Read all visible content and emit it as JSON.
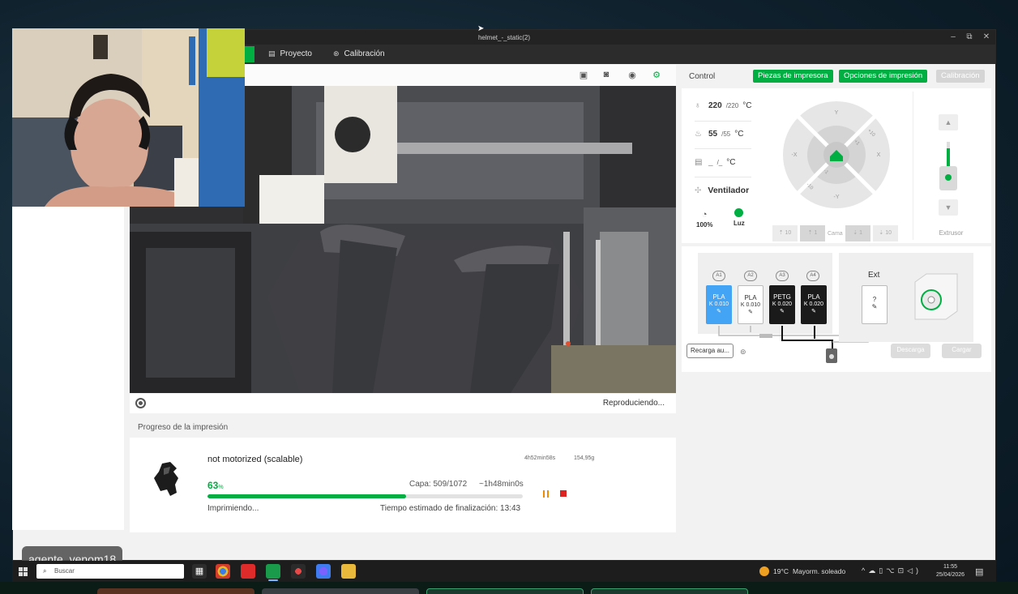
{
  "window": {
    "title": "helmet_-_static(2)",
    "controls": {
      "minimize": "–",
      "restore": "⧉",
      "close": "✕"
    }
  },
  "menubar": {
    "items": [
      {
        "label": "Proyecto",
        "icon": "project-icon"
      },
      {
        "label": "Calibración",
        "icon": "calibration-icon"
      }
    ]
  },
  "camera": {
    "status": "Reproduciendo...",
    "toolbar_icons": [
      "sd-card-icon",
      "camera-record-icon",
      "webcam-icon",
      "settings-gear-icon"
    ]
  },
  "progress": {
    "section_title": "Progreso de la impresión",
    "job_name": "not motorized (scalable)",
    "total_time": "4h52min58s",
    "weight": "154,95g",
    "percent_value": "63",
    "percent_unit": "%",
    "percent_fraction": 0.63,
    "layer": "Capa: 509/1072",
    "remaining": "~1h48min0s",
    "status": "Imprimiendo...",
    "eta": "Tiempo estimado de finalización: 13:43",
    "accent": "#00ae42"
  },
  "control": {
    "label": "Control",
    "buttons": {
      "parts": "Piezas de impresora",
      "options": "Opciones de impresión",
      "calibration": "Calibración"
    },
    "nozzle": {
      "current": "220",
      "target": "/220",
      "unit": "°C"
    },
    "bed": {
      "current": "55",
      "target": "/55",
      "unit": "°C"
    },
    "chamber": {
      "current": "_",
      "target": "/_",
      "unit": "°C"
    },
    "fan_label": "Ventilador",
    "speed": "100%",
    "light": "Luz",
    "jog": {
      "y_pos": "Y",
      "y_neg": "-Y",
      "x_pos": "X",
      "x_neg": "-X",
      "p10": "+10",
      "p1": "+1",
      "m1": "-1",
      "m10": "-10"
    },
    "bed_buttons": {
      "up10": "10",
      "up1": "1",
      "label": "Cama",
      "down1": "1",
      "down10": "10"
    },
    "extruder_label": "Extrusor"
  },
  "ams": {
    "slots": [
      {
        "label": "A1",
        "material": "PLA",
        "k": "K 0.010",
        "color": "#43a3f5"
      },
      {
        "label": "A2",
        "material": "PLA",
        "k": "K 0.010",
        "color": "#ffffff"
      },
      {
        "label": "A3",
        "material": "PETG",
        "k": "K 0.020",
        "color": "#1a1a1a"
      },
      {
        "label": "A4",
        "material": "PLA",
        "k": "K 0.020",
        "color": "#1a1a1a"
      }
    ],
    "ext_title": "Ext",
    "ext_value": "?",
    "recarga": "Recarga au...",
    "descarga": "Descarga",
    "cargar": "Cargar"
  },
  "overlay": {
    "streamer": "agente_venom18"
  },
  "taskbar": {
    "search_placeholder": "Buscar",
    "weather_temp": "19°C",
    "weather_desc": "Mayorm. soleado",
    "time": "11:55",
    "date": "25/04/2026"
  }
}
